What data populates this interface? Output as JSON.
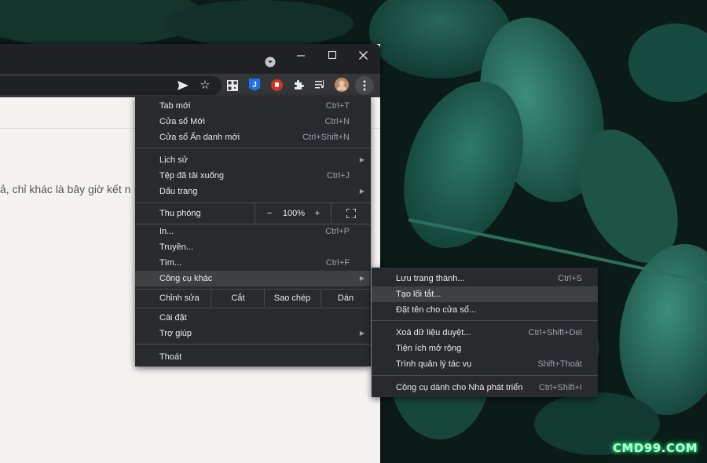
{
  "content": {
    "snippet": "ả, chỉ khác là bây giờ kết n"
  },
  "menu": {
    "items": [
      {
        "label": "Tab mới",
        "shortcut": "Ctrl+T"
      },
      {
        "label": "Cửa sổ Mới",
        "shortcut": "Ctrl+N"
      },
      {
        "label": "Cửa sổ Ẩn danh mới",
        "shortcut": "Ctrl+Shift+N"
      },
      {
        "label": "Lịch sử",
        "shortcut": ""
      },
      {
        "label": "Tệp đã tải xuống",
        "shortcut": "Ctrl+J"
      },
      {
        "label": "Dấu trang",
        "shortcut": ""
      },
      {
        "label": "In...",
        "shortcut": "Ctrl+P"
      },
      {
        "label": "Truyền...",
        "shortcut": ""
      },
      {
        "label": "Tìm...",
        "shortcut": "Ctrl+F"
      },
      {
        "label": "Công cụ khác",
        "shortcut": ""
      },
      {
        "label": "Cài đặt",
        "shortcut": ""
      },
      {
        "label": "Trợ giúp",
        "shortcut": ""
      },
      {
        "label": "Thoát",
        "shortcut": ""
      }
    ],
    "zoom": {
      "label": "Thu phóng",
      "minus": "−",
      "value": "100%",
      "plus": "+"
    },
    "edit": {
      "label": "Chỉnh sửa",
      "cut": "Cắt",
      "copy": "Sao chép",
      "paste": "Dán"
    }
  },
  "submenu": {
    "items": [
      {
        "label": "Lưu trang thành...",
        "shortcut": "Ctrl+S"
      },
      {
        "label": "Tạo lối tắt...",
        "shortcut": ""
      },
      {
        "label": "Đặt tên cho cửa sổ...",
        "shortcut": ""
      },
      {
        "label": "Xoá dữ liệu duyệt...",
        "shortcut": "Ctrl+Shift+Del"
      },
      {
        "label": "Tiện ích mở rộng",
        "shortcut": ""
      },
      {
        "label": "Trình quản lý tác vụ",
        "shortcut": "Shift+Thoát"
      },
      {
        "label": "Công cụ dành cho Nhà phát triển",
        "shortcut": "Ctrl+Shift+I"
      }
    ]
  },
  "watermark": "CMD99.COM",
  "colors": {
    "menu_bg": "#292a2d",
    "highlight": "#3f4042",
    "accent_red": "#d93025",
    "accent_blue": "#1a73e8",
    "watermark": "#b5ffd4"
  }
}
